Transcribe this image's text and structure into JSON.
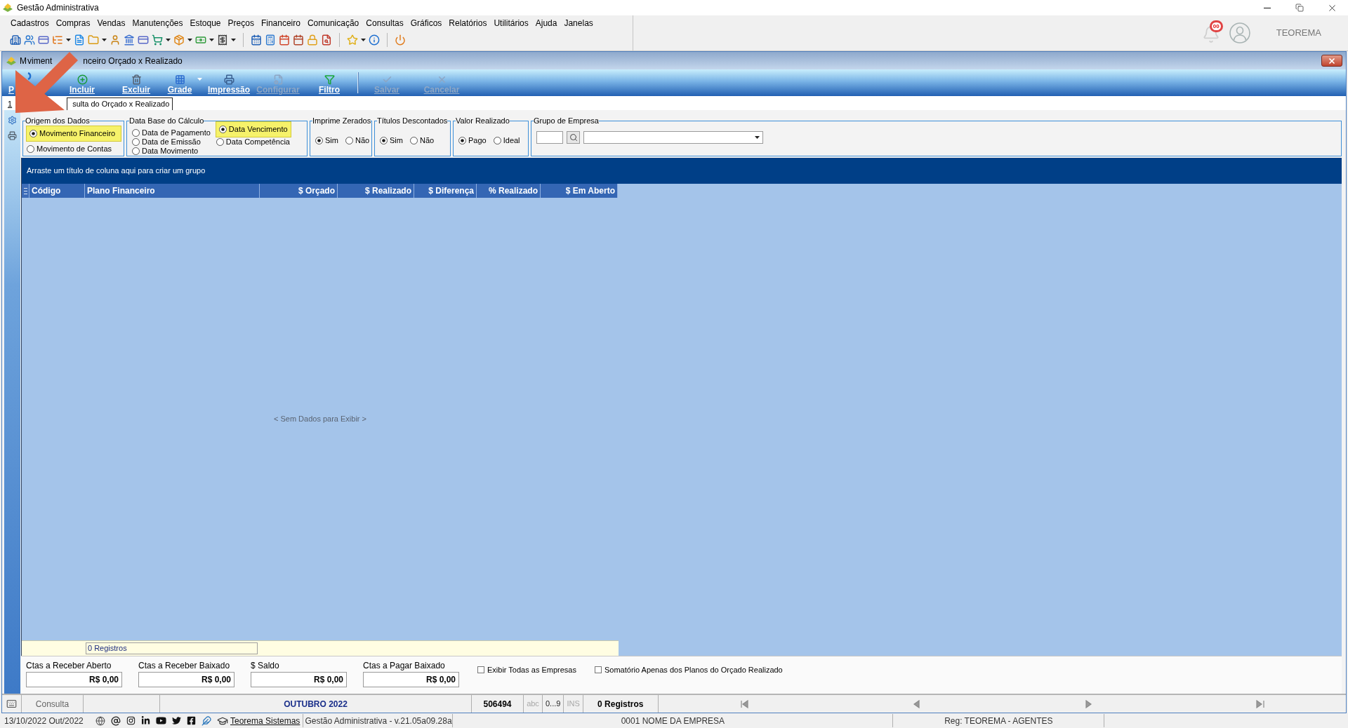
{
  "app": {
    "title": "Gestão Administrativa",
    "menu": [
      "Cadastros",
      "Compras",
      "Vendas",
      "Manutenções",
      "Estoque",
      "Preços",
      "Financeiro",
      "Comunicação",
      "Consultas",
      "Gráficos",
      "Relatórios",
      "Utilitários",
      "Ajuda",
      "Janelas"
    ],
    "notification_badge": "00",
    "user": "TEOREMA"
  },
  "window": {
    "title_parts": [
      "M",
      "viment",
      "nceiro Orçado x Realizado"
    ]
  },
  "toolbar": [
    {
      "label": "P",
      "disabled": false
    },
    {
      "label": "Incluir",
      "disabled": false
    },
    {
      "label": "Excluir",
      "disabled": false
    },
    {
      "label": "Grade",
      "disabled": false,
      "menu": true
    },
    {
      "label": "Impressão",
      "disabled": false
    },
    {
      "label": "Configurar",
      "disabled": true
    },
    {
      "label": "Filtro",
      "disabled": false
    },
    {
      "label": "Salvar",
      "disabled": true,
      "separator_before": true
    },
    {
      "label": "Cancelar",
      "disabled": true
    }
  ],
  "tabs": [
    {
      "label": "1",
      "selected": false
    },
    {
      "label": "sulta do Orçado x Realizado",
      "selected": true
    }
  ],
  "filters": [
    {
      "kind": "stack",
      "title": "Origem dos Dados",
      "options": [
        {
          "label": "Movimento Financeiro",
          "selected": true,
          "highlighted": true
        },
        {
          "label": "Movimento de Contas",
          "selected": false,
          "highlighted": false
        }
      ]
    },
    {
      "kind": "columns",
      "title": "Data Base do Cálculo",
      "columns": [
        [
          {
            "label": "Data de Pagamento",
            "selected": false,
            "highlighted": false
          },
          {
            "label": "Data de Emissão",
            "selected": false,
            "highlighted": false
          },
          {
            "label": "Data Movimento",
            "selected": false,
            "highlighted": false
          }
        ],
        [
          {
            "label": "Data Vencimento",
            "selected": true,
            "highlighted": true
          },
          {
            "label": "Data Competência",
            "selected": false,
            "highlighted": false
          }
        ]
      ]
    },
    {
      "kind": "row",
      "title": "Imprime Zerados",
      "options": [
        {
          "label": "Sim",
          "selected": true,
          "highlighted": false
        },
        {
          "label": "Não",
          "selected": false,
          "highlighted": false
        }
      ]
    },
    {
      "kind": "row",
      "title": "Títulos Descontados",
      "options": [
        {
          "label": "Sim",
          "selected": true,
          "highlighted": false
        },
        {
          "label": "Não",
          "selected": false,
          "highlighted": false
        }
      ]
    },
    {
      "kind": "row",
      "title": "Valor Realizado",
      "options": [
        {
          "label": "Pago",
          "selected": true,
          "highlighted": false
        },
        {
          "label": "Ideal",
          "selected": false,
          "highlighted": false
        }
      ]
    },
    {
      "kind": "lookup",
      "title": "Grupo de Empresa"
    }
  ],
  "grid": {
    "group_hint": "Arraste um título de coluna aqui para criar um grupo",
    "columns": [
      {
        "label": "Código",
        "kind": "text"
      },
      {
        "label": "Plano Financeiro",
        "kind": "text"
      },
      {
        "label": "$ Orçado",
        "kind": "number"
      },
      {
        "label": "$ Realizado",
        "kind": "number"
      },
      {
        "label": "$ Diferença",
        "kind": "number"
      },
      {
        "label": "% Realizado",
        "kind": "number"
      },
      {
        "label": "$ Em Aberto",
        "kind": "number"
      }
    ],
    "empty_text": "< Sem Dados para Exibir >",
    "footer_count": "0 Registros"
  },
  "totals": [
    {
      "label": "Ctas a Receber Aberto",
      "value": "R$ 0,00"
    },
    {
      "label": "Ctas a Receber Baixado",
      "value": "R$ 0,00"
    },
    {
      "label": "$ Saldo",
      "value": "R$ 0,00"
    },
    {
      "label": "Ctas a Pagar Baixado",
      "value": "R$ 0,00"
    }
  ],
  "checkboxes": [
    {
      "label": "Exibir Todas as Empresas",
      "checked": false
    },
    {
      "label": "Somatório Apenas dos Planos do Orçado Realizado",
      "checked": false
    }
  ],
  "status_bar": {
    "mode": "Consulta",
    "period": "OUTUBRO 2022",
    "code": "506494",
    "indicators": [
      {
        "label": "abc",
        "on": false
      },
      {
        "label": "0...9",
        "on": true
      },
      {
        "label": "INS",
        "on": false
      }
    ],
    "records": "0 Registros"
  },
  "footer": {
    "date": "13/10/2022 Out/2022",
    "link": "Teorema Sistemas",
    "version": "Gestão Administrativa - v.21.05a09.28a",
    "company": "0001 NOME DA EMPRESA",
    "registration": "Reg: TEOREMA - AGENTES"
  }
}
